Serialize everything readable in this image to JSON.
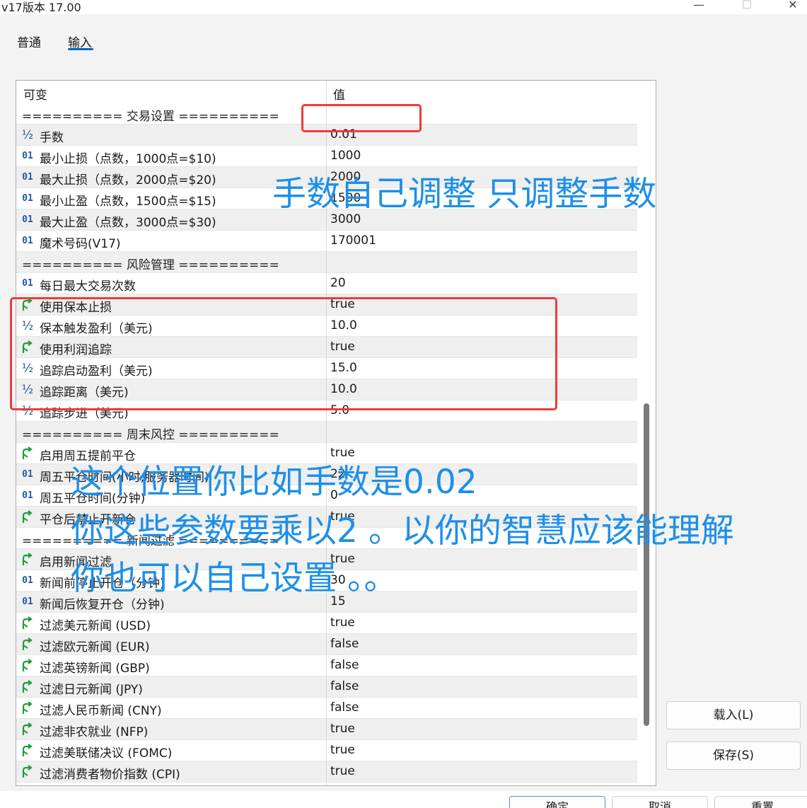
{
  "window": {
    "title": "v17版本 17.00",
    "minimize_glyph": "—",
    "maximize_glyph": "☐",
    "close_glyph": "✕"
  },
  "tabs": [
    {
      "label": "普通",
      "active": false
    },
    {
      "label": "输入",
      "active": true
    }
  ],
  "grid": {
    "columns": [
      "可变",
      "值"
    ],
    "rows": [
      {
        "icon": "",
        "name": "========== 交易设置 ==========",
        "value": "",
        "section": true
      },
      {
        "icon": "fraction",
        "name": "手数",
        "value": "0.01"
      },
      {
        "icon": "integer",
        "name": "最小止损（点数，1000点=$10)",
        "value": "1000"
      },
      {
        "icon": "integer",
        "name": "最大止损（点数，2000点=$20)",
        "value": "2000"
      },
      {
        "icon": "integer",
        "name": "最小止盈（点数，1500点=$15)",
        "value": "1500"
      },
      {
        "icon": "integer",
        "name": "最大止盈（点数，3000点=$30)",
        "value": "3000"
      },
      {
        "icon": "integer",
        "name": "魔术号码(V17)",
        "value": "170001"
      },
      {
        "icon": "",
        "name": "========== 风险管理 ==========",
        "value": "",
        "section": true
      },
      {
        "icon": "integer",
        "name": "每日最大交易次数",
        "value": "20"
      },
      {
        "icon": "boolean",
        "name": "使用保本止损",
        "value": "true"
      },
      {
        "icon": "fraction",
        "name": "保本触发盈利（美元)",
        "value": "10.0"
      },
      {
        "icon": "boolean",
        "name": "使用利润追踪",
        "value": "true"
      },
      {
        "icon": "fraction",
        "name": "追踪启动盈利（美元)",
        "value": "15.0"
      },
      {
        "icon": "fraction",
        "name": "追踪距离（美元)",
        "value": "10.0"
      },
      {
        "icon": "fraction",
        "name": "追踪步进（美元)",
        "value": "5.0"
      },
      {
        "icon": "",
        "name": "========== 周末风控 ==========",
        "value": "",
        "section": true
      },
      {
        "icon": "boolean",
        "name": "启用周五提前平仓",
        "value": "true"
      },
      {
        "icon": "integer",
        "name": "周五平仓时间(小时,服务器时间)",
        "value": "22"
      },
      {
        "icon": "integer",
        "name": "周五平仓时间(分钟)",
        "value": "0"
      },
      {
        "icon": "boolean",
        "name": "平仓后禁止开新仓",
        "value": "true"
      },
      {
        "icon": "",
        "name": "========== 新闻过滤 ==========",
        "value": "",
        "section": true
      },
      {
        "icon": "boolean",
        "name": "启用新闻过滤",
        "value": "true"
      },
      {
        "icon": "integer",
        "name": "新闻前停止开仓（分钟)",
        "value": "30"
      },
      {
        "icon": "integer",
        "name": "新闻后恢复开仓（分钟)",
        "value": "15"
      },
      {
        "icon": "boolean",
        "name": "过滤美元新闻 (USD)",
        "value": "true"
      },
      {
        "icon": "boolean",
        "name": "过滤欧元新闻 (EUR)",
        "value": "false"
      },
      {
        "icon": "boolean",
        "name": "过滤英镑新闻 (GBP)",
        "value": "false"
      },
      {
        "icon": "boolean",
        "name": "过滤日元新闻 (JPY)",
        "value": "false"
      },
      {
        "icon": "boolean",
        "name": "过滤人民币新闻 (CNY)",
        "value": "false"
      },
      {
        "icon": "boolean",
        "name": "过滤非农就业 (NFP)",
        "value": "true"
      },
      {
        "icon": "boolean",
        "name": "过滤美联储决议 (FOMC)",
        "value": "true"
      },
      {
        "icon": "boolean",
        "name": "过滤消费者物价指数 (CPI)",
        "value": "true"
      }
    ]
  },
  "side_buttons": {
    "load": "载入(L)",
    "save": "保存(S)"
  },
  "bottom_buttons": {
    "ok": "确定",
    "cancel": "取消",
    "reset": "重置"
  },
  "annotations": {
    "note1": "手数自己调整 只调整手数",
    "note2_line1": "这个位置你比如手数是0.02",
    "note2_line2": "你这些参数要乘以2 。以你的智慧应该能理解",
    "note2_line3": "你也可以自己设置 。。",
    "text_color": "#1e8fe8",
    "box_color": "#ef3b3b"
  }
}
